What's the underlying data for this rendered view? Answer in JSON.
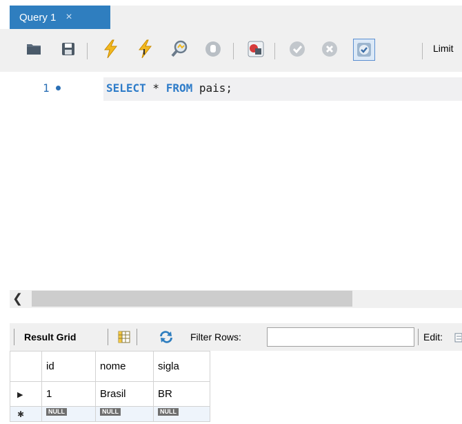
{
  "tab": {
    "title": "Query 1",
    "close_glyph": "×"
  },
  "toolbar": {
    "limit_label": "Limit",
    "icons": [
      "open-folder-icon",
      "save-icon",
      "execute-icon",
      "execute-current-icon",
      "explain-icon",
      "stop-icon",
      "stop-on-error-icon",
      "commit-icon",
      "rollback-icon",
      "autocommit-icon"
    ]
  },
  "editor": {
    "line_number": "1",
    "code": {
      "kw1": "SELECT",
      "star": " * ",
      "kw2": "FROM",
      "rest": " pais;"
    }
  },
  "results": {
    "result_grid_label": "Result Grid",
    "filter_label": "Filter Rows:",
    "filter_value": "",
    "edit_label": "Edit:",
    "columns": [
      "id",
      "nome",
      "sigla"
    ],
    "rows": [
      {
        "id": "1",
        "nome": "Brasil",
        "sigla": "BR"
      }
    ],
    "null_label": "NULL"
  },
  "colors": {
    "accent": "#2f7ebf",
    "keyword": "#2e7cc9",
    "toolbar_bg": "#f0f0f0"
  }
}
